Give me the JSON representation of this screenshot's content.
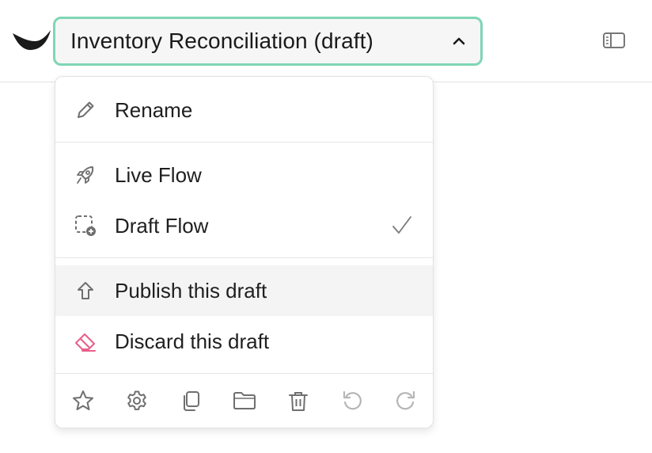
{
  "header": {
    "title": "Inventory Reconciliation (draft)"
  },
  "menu": {
    "items": [
      {
        "label": "Rename",
        "icon": "pencil-icon"
      },
      {
        "label": "Live Flow",
        "icon": "rocket-icon"
      },
      {
        "label": "Draft Flow",
        "icon": "draft-add-icon",
        "selected": true
      },
      {
        "label": "Publish this draft",
        "icon": "arrow-up-icon",
        "hovered": true
      },
      {
        "label": "Discard this draft",
        "icon": "eraser-icon"
      }
    ],
    "toolbar_icons": [
      "star-icon",
      "gear-icon",
      "copy-icon",
      "folder-icon",
      "trash-icon",
      "undo-icon",
      "redo-icon"
    ]
  },
  "colors": {
    "accent_border": "#7ed6b5",
    "discard_icon": "#e8608a",
    "icon_gray": "#6f6f6f",
    "disabled_gray": "#b5b5b5"
  }
}
